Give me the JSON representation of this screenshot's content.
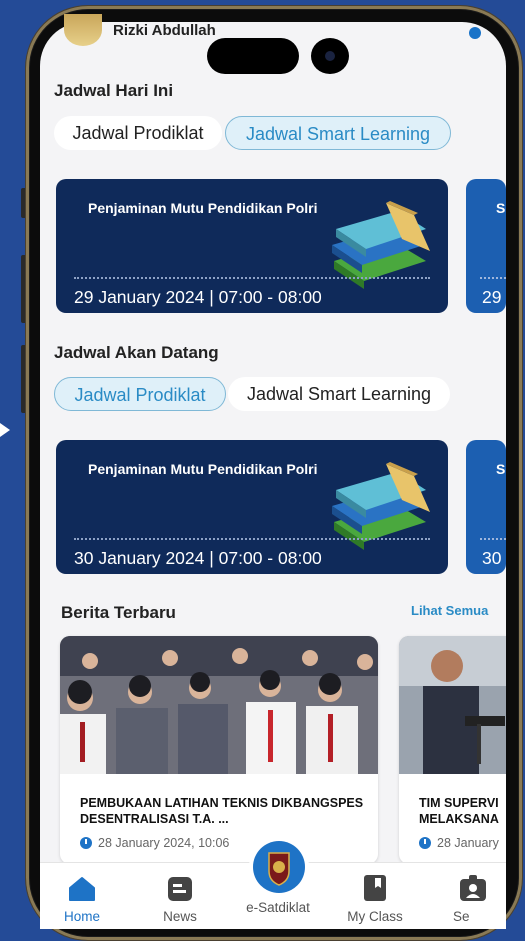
{
  "header": {
    "username": "Rizki Abdullah"
  },
  "today": {
    "title": "Jadwal Hari Ini",
    "tabs": [
      {
        "label": "Jadwal Prodiklat",
        "active": false
      },
      {
        "label": "Jadwal Smart Learning",
        "active": true
      }
    ],
    "card": {
      "title": "Penjaminan Mutu Pendidikan Polri",
      "datetime": "29 January 2024 | 07:00 - 08:00"
    },
    "peek": {
      "title_initial": "S",
      "date_initial": "29"
    }
  },
  "upcoming": {
    "title": "Jadwal Akan Datang",
    "tabs": [
      {
        "label": "Jadwal Prodiklat",
        "active": true
      },
      {
        "label": "Jadwal Smart Learning",
        "active": false
      }
    ],
    "card": {
      "title": "Penjaminan Mutu Pendidikan Polri",
      "datetime": "30 January 2024 | 07:00 - 08:00"
    },
    "peek": {
      "title_initial": "S",
      "date_initial": "30"
    }
  },
  "news": {
    "title": "Berita Terbaru",
    "see_all": "Lihat Semua",
    "items": [
      {
        "title": "PEMBUKAAN LATIHAN TEKNIS DIKBANGSPES DESENTRALISASI T.A. ...",
        "date": "28 January 2024, 10:06"
      },
      {
        "title": "TIM SUPERVI MELAKSANA",
        "date": "28 January"
      }
    ]
  },
  "nav": {
    "items": [
      {
        "label": "Home",
        "active": true
      },
      {
        "label": "News"
      },
      {
        "label": "e-Satdiklat"
      },
      {
        "label": "My Class"
      },
      {
        "label": "Se"
      }
    ]
  },
  "colors": {
    "accent": "#2a8bc5",
    "card_bg": "#0f2a5a",
    "nav_active": "#1e73c6",
    "background": "#244b97"
  }
}
